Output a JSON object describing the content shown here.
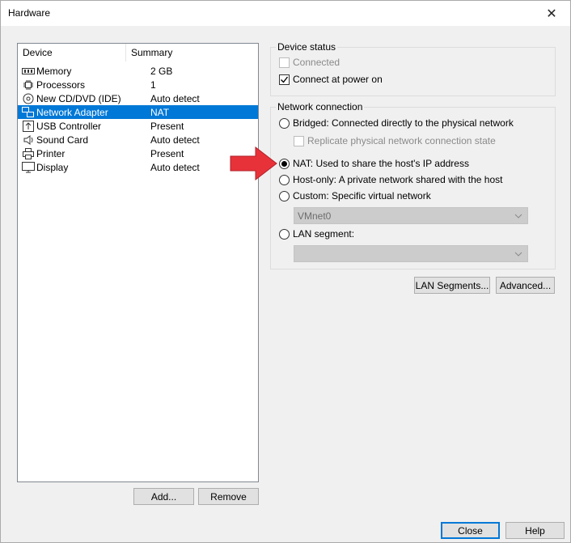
{
  "window": {
    "title": "Hardware",
    "close_symbol": "✕"
  },
  "device_list": {
    "headers": {
      "device": "Device",
      "summary": "Summary"
    },
    "rows": [
      {
        "name": "Memory",
        "summary": "2 GB",
        "icon": "memory-icon"
      },
      {
        "name": "Processors",
        "summary": "1",
        "icon": "processor-icon"
      },
      {
        "name": "New CD/DVD (IDE)",
        "summary": "Auto detect",
        "icon": "cd-dvd-icon"
      },
      {
        "name": "Network Adapter",
        "summary": "NAT",
        "icon": "network-adapter-icon",
        "selected": true
      },
      {
        "name": "USB Controller",
        "summary": "Present",
        "icon": "usb-icon"
      },
      {
        "name": "Sound Card",
        "summary": "Auto detect",
        "icon": "speaker-icon"
      },
      {
        "name": "Printer",
        "summary": "Present",
        "icon": "printer-icon"
      },
      {
        "name": "Display",
        "summary": "Auto detect",
        "icon": "monitor-icon"
      }
    ],
    "add_label": "Add...",
    "remove_label": "Remove"
  },
  "device_status": {
    "title": "Device status",
    "connected_label": "Connected",
    "connected_checked": false,
    "connect_power_label": "Connect at power on",
    "connect_power_checked": true
  },
  "network_connection": {
    "title": "Network connection",
    "bridged_label": "Bridged: Connected directly to the physical network",
    "replicate_label": "Replicate physical network connection state",
    "nat_label": "NAT: Used to share the host's IP address",
    "hostonly_label": "Host-only: A private network shared with the host",
    "custom_label": "Custom: Specific virtual network",
    "custom_value": "VMnet0",
    "lan_label": "LAN segment:",
    "lan_value": "",
    "selected": "nat"
  },
  "buttons": {
    "lan_segments": "LAN Segments...",
    "advanced": "Advanced...",
    "close": "Close",
    "help": "Help"
  },
  "colors": {
    "selection": "#0078d7",
    "arrow": "#e8323a"
  }
}
